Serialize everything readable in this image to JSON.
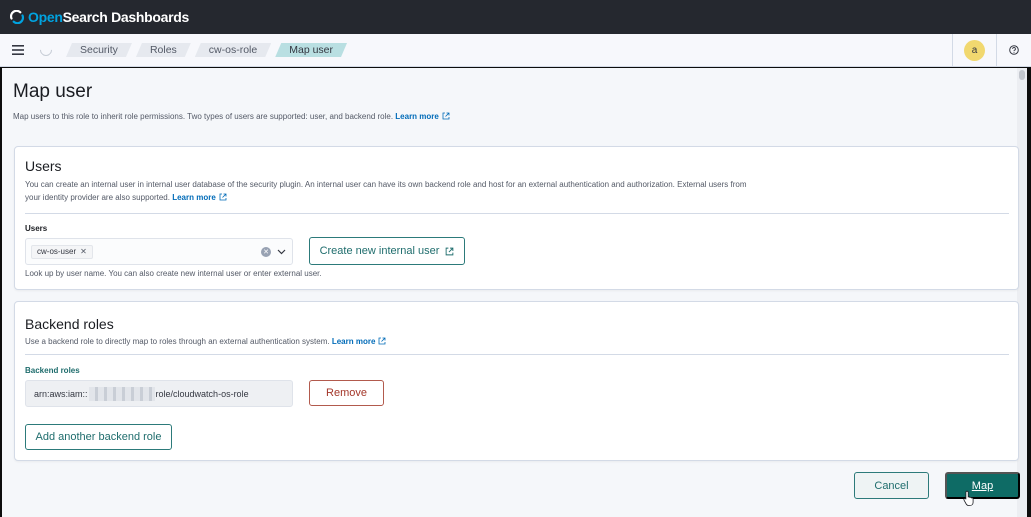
{
  "app": {
    "logo_open": "Open",
    "logo_rest": "Search Dashboards"
  },
  "breadcrumbs": [
    {
      "label": "Security"
    },
    {
      "label": "Roles"
    },
    {
      "label": "cw-os-role"
    },
    {
      "label": "Map user"
    }
  ],
  "header": {
    "avatar_initial": "a"
  },
  "page": {
    "title": "Map user",
    "description": "Map users to this role to inherit role permissions. Two types of users are supported: user, and backend role.",
    "learn_more": "Learn more"
  },
  "users_panel": {
    "title": "Users",
    "description": "You can create an internal user in internal user database of the security plugin. An internal user can have its own backend role and host for an external authentication and authorization. External users from your identity provider are also supported.",
    "learn_more": "Learn more",
    "field_label": "Users",
    "selected_user": "cw-os-user",
    "help_text": "Look up by user name. You can also create new internal user or enter external user.",
    "create_button": "Create new internal user"
  },
  "backend_panel": {
    "title": "Backend roles",
    "description": "Use a backend role to directly map to roles through an external authentication system.",
    "learn_more": "Learn more",
    "field_label": "Backend roles",
    "arn_prefix": "arn:aws:iam::",
    "arn_suffix": "role/cloudwatch-os-role",
    "remove_button": "Remove",
    "add_button": "Add another backend role"
  },
  "footer": {
    "cancel_button": "Cancel",
    "map_button": "Map"
  },
  "colors": {
    "primary": "#0e6b65",
    "danger": "#a4372a",
    "header_bg": "#25282f",
    "logo_accent": "#00a3e0"
  }
}
